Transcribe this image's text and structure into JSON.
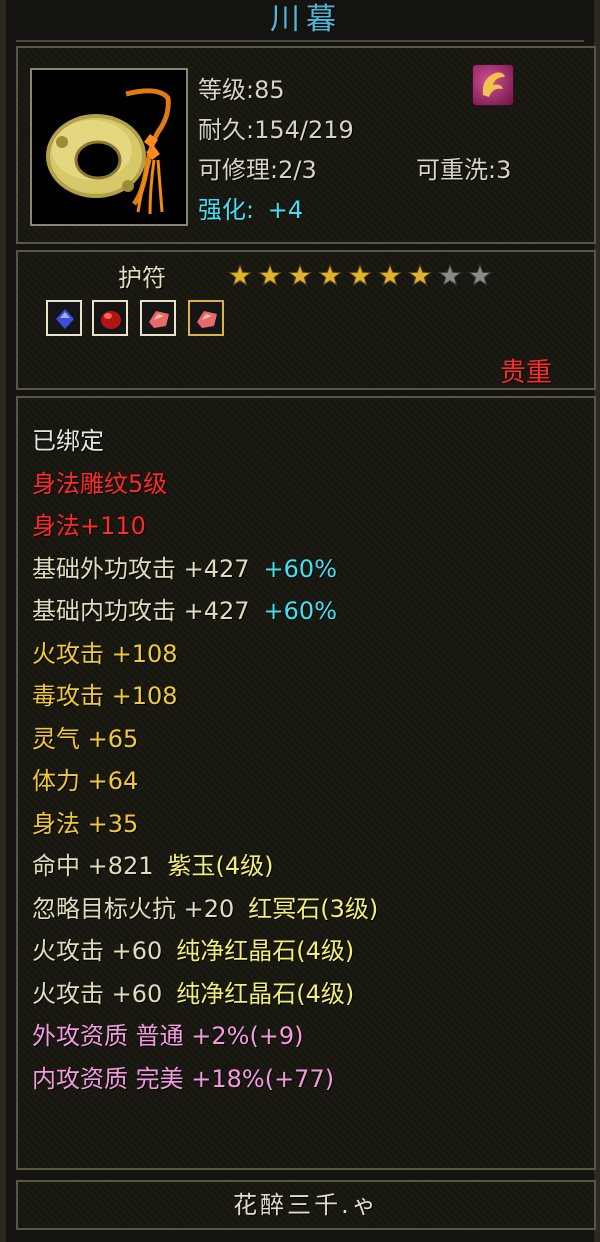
{
  "item": {
    "name": "川暮",
    "level": "等级:85",
    "durability": "耐久:154/219",
    "repairable": "可修理:2/3",
    "rewash": "可重洗:3",
    "enhance_label": "强化:",
    "enhance_value": "+4",
    "type": "护符",
    "stars": {
      "filled": 7,
      "total": 9
    },
    "rarity": "贵重",
    "gem_slots": [
      "blue-gem-icon",
      "red-gem-icon",
      "pink-gem-icon",
      "pink-gem-icon"
    ]
  },
  "attributes": [
    {
      "text": "已绑定",
      "color": "white"
    },
    {
      "text": "身法雕纹5级",
      "color": "red"
    },
    {
      "text": "身法+110",
      "color": "red"
    },
    {
      "text": "基础外功攻击  +427",
      "extra": "+60%",
      "color": "beige"
    },
    {
      "text": "基础内功攻击  +427",
      "extra": "+60%",
      "color": "beige"
    },
    {
      "text": "火攻击  +108",
      "color": "gold"
    },
    {
      "text": "毒攻击  +108",
      "color": "gold"
    },
    {
      "text": "灵气  +65",
      "color": "gold"
    },
    {
      "text": "体力  +64",
      "color": "gold"
    },
    {
      "text": "身法  +35",
      "color": "gold"
    },
    {
      "text": "命中  +821",
      "gem": "紫玉(4级)",
      "color": "beige"
    },
    {
      "text": "忽略目标火抗  +20",
      "gem": "红冥石(3级)",
      "color": "beige"
    },
    {
      "text": "火攻击  +60",
      "gem": "纯净红晶石(4级)",
      "color": "beige"
    },
    {
      "text": "火攻击  +60",
      "gem": "纯净红晶石(4级)",
      "color": "beige"
    },
    {
      "text": "外攻资质   普通  +2%(+9)",
      "color": "pink"
    },
    {
      "text": "内攻资质   完美  +18%(+77)",
      "color": "pink"
    }
  ],
  "footer": {
    "owner": "花醉三千.ゃ"
  },
  "colors": {
    "title": "#4fb6d6",
    "enhance": "#43e0f2",
    "rare": "#ff2a2a",
    "gold": "#f0c93b",
    "pink": "#f29bde"
  }
}
